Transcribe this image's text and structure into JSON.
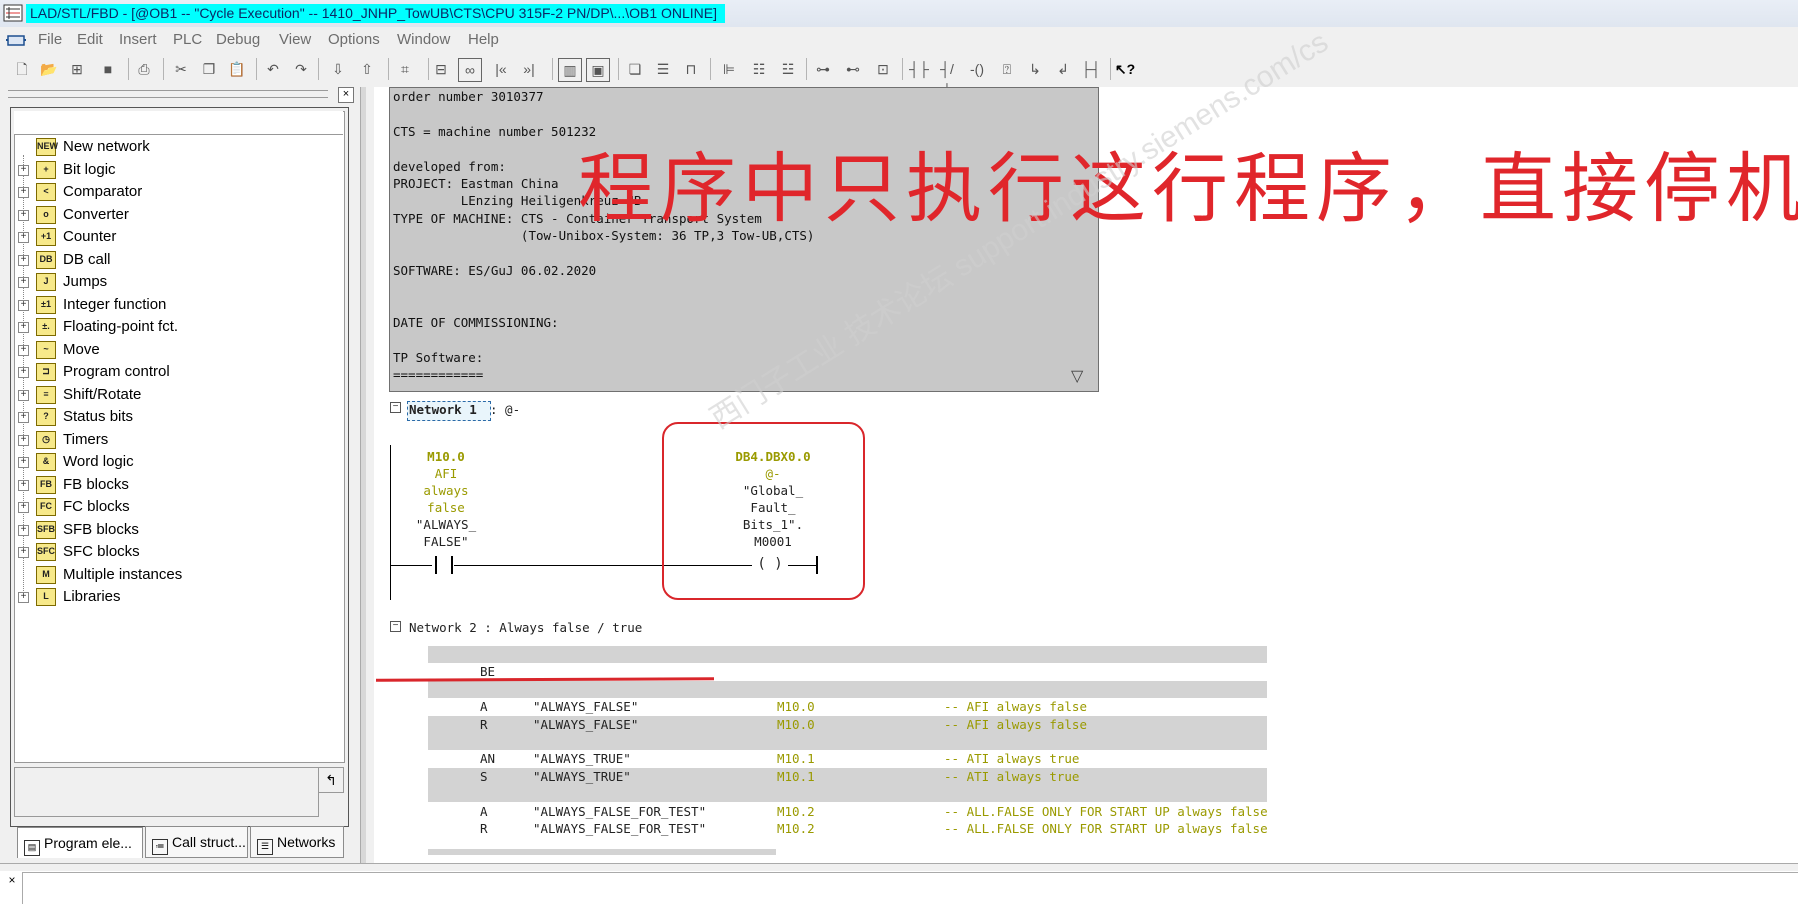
{
  "window": {
    "title": "LAD/STL/FBD  - [@OB1 -- \"Cycle Execution\" -- 1410_JNHP_TowUB\\CTS\\CPU 315F-2 PN/DP\\...\\OB1  ONLINE]",
    "title_highlight_color": "#00ffff"
  },
  "menu": [
    "File",
    "Edit",
    "Insert",
    "PLC",
    "Debug",
    "View",
    "Options",
    "Window",
    "Help"
  ],
  "toolbar_icons": [
    "new-icon",
    "open-icon",
    "accessible-nodes-icon",
    "save-icon",
    "print-icon",
    "cut-icon",
    "copy-icon",
    "paste-icon",
    "undo-icon",
    "redo-icon",
    "download-icon",
    "upload-icon",
    "select-icon",
    "monitor-icon",
    "glasses-icon",
    "prev-network-icon",
    "next-network-icon",
    "overview-icon",
    "details-icon",
    "cascade-icon",
    "tile-icon",
    "window-icon",
    "lad-icon",
    "stl-icon",
    "fbd-icon",
    "contact-icon",
    "branch-icon",
    "coil-icon",
    "box-icon",
    "open-branch-icon",
    "close-branch-icon",
    "connection-icon",
    "help-icon"
  ],
  "toolbar_glyphs": {
    "prev_network": "|«",
    "next_network": "»|"
  },
  "program_elements": {
    "items": [
      {
        "label": "New network",
        "icon": "new-network-icon",
        "glyph": "NEW",
        "expandable": false
      },
      {
        "label": "Bit logic",
        "icon": "bit-logic-icon",
        "glyph": "+",
        "expandable": true
      },
      {
        "label": "Comparator",
        "icon": "comparator-icon",
        "glyph": "<",
        "expandable": true
      },
      {
        "label": "Converter",
        "icon": "converter-icon",
        "glyph": "o",
        "expandable": true
      },
      {
        "label": "Counter",
        "icon": "counter-icon",
        "glyph": "+1",
        "expandable": true
      },
      {
        "label": "DB call",
        "icon": "db-call-icon",
        "glyph": "DB",
        "expandable": true
      },
      {
        "label": "Jumps",
        "icon": "jumps-icon",
        "glyph": "J",
        "expandable": true
      },
      {
        "label": "Integer function",
        "icon": "integer-function-icon",
        "glyph": "±1",
        "expandable": true
      },
      {
        "label": "Floating-point fct.",
        "icon": "floating-point-icon",
        "glyph": "±.",
        "expandable": true
      },
      {
        "label": "Move",
        "icon": "move-icon",
        "glyph": "~",
        "expandable": true
      },
      {
        "label": "Program control",
        "icon": "program-control-icon",
        "glyph": "⊐",
        "expandable": true
      },
      {
        "label": "Shift/Rotate",
        "icon": "shift-rotate-icon",
        "glyph": "≡",
        "expandable": true
      },
      {
        "label": "Status bits",
        "icon": "status-bits-icon",
        "glyph": "?",
        "expandable": true
      },
      {
        "label": "Timers",
        "icon": "timers-icon",
        "glyph": "◷",
        "expandable": true
      },
      {
        "label": "Word logic",
        "icon": "word-logic-icon",
        "glyph": "&",
        "expandable": true
      },
      {
        "label": "FB blocks",
        "icon": "fb-blocks-icon",
        "glyph": "FB",
        "expandable": true
      },
      {
        "label": "FC blocks",
        "icon": "fc-blocks-icon",
        "glyph": "FC",
        "expandable": true
      },
      {
        "label": "SFB blocks",
        "icon": "sfb-blocks-icon",
        "glyph": "SFB",
        "expandable": true
      },
      {
        "label": "SFC blocks",
        "icon": "sfc-blocks-icon",
        "glyph": "SFC",
        "expandable": true
      },
      {
        "label": "Multiple instances",
        "icon": "multiple-instances-icon",
        "glyph": "M",
        "expandable": false
      },
      {
        "label": "Libraries",
        "icon": "libraries-icon",
        "glyph": "L",
        "expandable": true
      }
    ],
    "tabs": [
      {
        "label": "Program ele...",
        "icon": "program-elements-tab-icon"
      },
      {
        "label": "Call struct...",
        "icon": "call-structure-tab-icon"
      },
      {
        "label": "Networks",
        "icon": "networks-tab-icon"
      }
    ],
    "detail_button_glyph": "↰"
  },
  "block_comment": {
    "lines": [
      "order number 3010377",
      "",
      "CTS = machine number 501232",
      "",
      "developed from:",
      "PROJECT: Eastman China",
      "         LEnzing Heiligenkreuz UB",
      "TYPE OF MACHINE: CTS - Container Transport System",
      "                 (Tow-Unibox-System: 36 TP,3 Tow-UB,CTS)",
      "",
      "SOFTWARE: ES/GuJ 06.02.2020",
      "",
      "",
      "DATE OF COMMISSIONING:",
      "",
      "TP Software:",
      "============"
    ],
    "scroll_glyph": "▽"
  },
  "network1": {
    "toggle": "−",
    "title_prefix": "Network 1",
    "title_suffix": ": @-",
    "contact": {
      "address": "M10.0",
      "comment_lines": [
        "AFI",
        "always",
        "false"
      ],
      "symbol_lines": [
        "\"ALWAYS_",
        "FALSE\""
      ]
    },
    "coil": {
      "address": "DB4.DBX0.0",
      "comment": "@-",
      "symbol_lines": [
        "\"Global_",
        "Fault_",
        "Bits_1\".",
        "M0001"
      ],
      "glyph": "( )"
    }
  },
  "network2": {
    "toggle": "−",
    "title": "Network 2 : Always false / true",
    "rows": [
      {
        "ins": "",
        "sym": "",
        "addr": "",
        "com": ""
      },
      {
        "ins": "BE",
        "sym": "",
        "addr": "",
        "com": ""
      },
      {
        "ins": "",
        "sym": "",
        "addr": "",
        "com": ""
      },
      {
        "ins": "A",
        "sym": "\"ALWAYS_FALSE\"",
        "addr": "M10.0",
        "com": "-- AFI always false"
      },
      {
        "ins": "R",
        "sym": "\"ALWAYS_FALSE\"",
        "addr": "M10.0",
        "com": "-- AFI always false"
      },
      {
        "ins": "",
        "sym": "",
        "addr": "",
        "com": ""
      },
      {
        "ins": "AN",
        "sym": "\"ALWAYS_TRUE\"",
        "addr": "M10.1",
        "com": "-- ATI always true"
      },
      {
        "ins": "S",
        "sym": "\"ALWAYS_TRUE\"",
        "addr": "M10.1",
        "com": "-- ATI always true"
      },
      {
        "ins": "",
        "sym": "",
        "addr": "",
        "com": ""
      },
      {
        "ins": "A",
        "sym": "\"ALWAYS_FALSE_FOR_TEST\"",
        "addr": "M10.2",
        "com": "-- ALL.FALSE ONLY FOR START UP always false"
      },
      {
        "ins": "R",
        "sym": "\"ALWAYS_FALSE_FOR_TEST\"",
        "addr": "M10.2",
        "com": "-- ALL.FALSE ONLY FOR START UP always false"
      }
    ]
  },
  "annotation": {
    "text": "程序中只执行这行程序，直接停机",
    "color": "#e0262b"
  },
  "watermark": "西门子工业 技术论坛 support.industry.siemens.com/cs",
  "bottom": {
    "close_glyph": "×"
  },
  "panel": {
    "close_glyph": "×"
  }
}
